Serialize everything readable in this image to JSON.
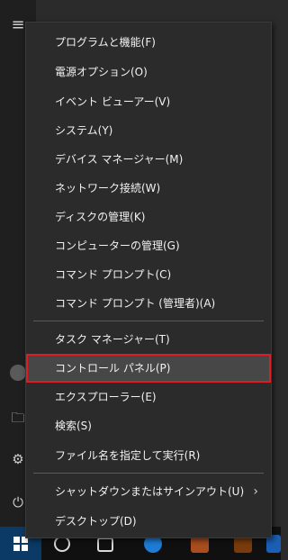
{
  "menu": {
    "items": [
      {
        "label": "プログラムと機能(F)"
      },
      {
        "label": "電源オプション(O)"
      },
      {
        "label": "イベント ビューアー(V)"
      },
      {
        "label": "システム(Y)"
      },
      {
        "label": "デバイス マネージャー(M)"
      },
      {
        "label": "ネットワーク接続(W)"
      },
      {
        "label": "ディスクの管理(K)"
      },
      {
        "label": "コンピューターの管理(G)"
      },
      {
        "label": "コマンド プロンプト(C)"
      },
      {
        "label": "コマンド プロンプト (管理者)(A)"
      },
      {
        "label": "タスク マネージャー(T)"
      },
      {
        "label": "コントロール パネル(P)"
      },
      {
        "label": "エクスプローラー(E)"
      },
      {
        "label": "検索(S)"
      },
      {
        "label": "ファイル名を指定して実行(R)"
      },
      {
        "label": "シャットダウンまたはサインアウト(U)"
      },
      {
        "label": "デスクトップ(D)"
      }
    ],
    "selected_item": "コントロール パネル(P)",
    "submenu_arrow": "›",
    "highlight_color": "#e01b24"
  },
  "rail": {
    "hamburger_icon": "≡",
    "explorer_icon": "🗀",
    "settings_icon": "⚙",
    "power_icon": "⏻"
  }
}
